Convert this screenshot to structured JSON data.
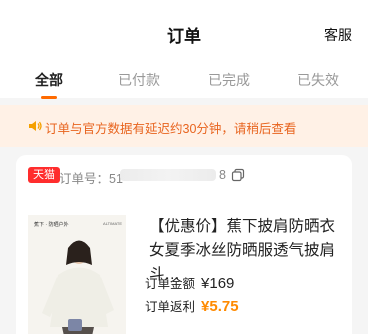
{
  "header": {
    "title": "订单",
    "service_label": "客服"
  },
  "tabs": [
    {
      "label": "全部",
      "active": true
    },
    {
      "label": "已付款",
      "active": false
    },
    {
      "label": "已完成",
      "active": false
    },
    {
      "label": "已失效",
      "active": false
    }
  ],
  "notice": {
    "icon": "speaker-icon",
    "text": "订单与官方数据有延迟约30分钟，请稍后查看"
  },
  "order": {
    "platform_badge": "天猫",
    "order_label": "订单号：51",
    "order_tail": "8",
    "product": {
      "brand_line": "蕉下 · 防晒户外",
      "brand_right": "ALTIMATE",
      "title": "【优惠价】蕉下披肩防晒衣女夏季冰丝防晒服透气披肩斗…",
      "amount_label": "订单金额",
      "amount_value": "¥169",
      "rebate_label": "订单返利",
      "rebate_value": "¥5.75"
    }
  },
  "colors": {
    "accent": "#ff6a00",
    "rebate": "#ff8a00",
    "notice_bg": "#fff1e6",
    "notice_text": "#e8641e",
    "tmall": "#ff2d2d"
  }
}
